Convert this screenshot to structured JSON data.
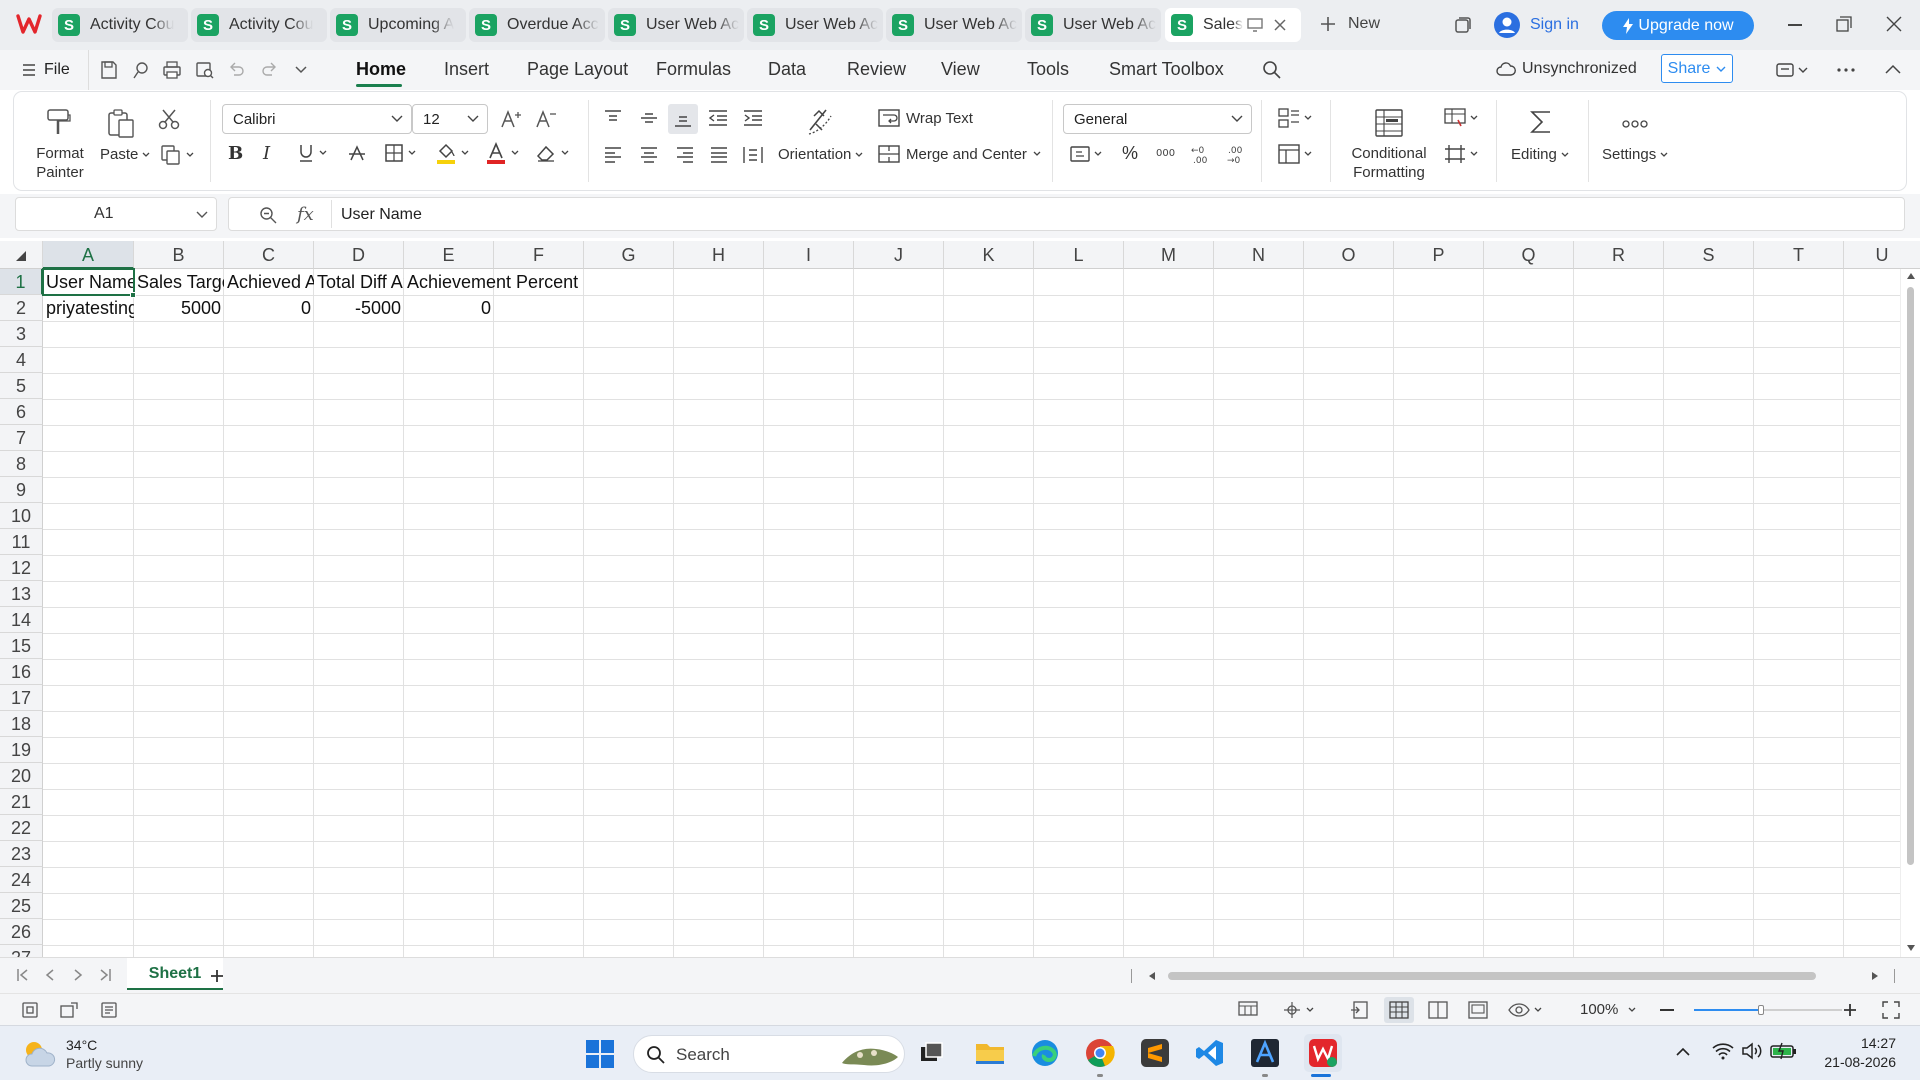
{
  "tabs": [
    {
      "label": "Activity Cou",
      "icon": "S"
    },
    {
      "label": "Activity Cou",
      "icon": "S"
    },
    {
      "label": "Upcoming A",
      "icon": "S"
    },
    {
      "label": "Overdue Acc",
      "icon": "S"
    },
    {
      "label": "User Web Ac",
      "icon": "S"
    },
    {
      "label": "User Web Ac",
      "icon": "S"
    },
    {
      "label": "User Web Ac",
      "icon": "S"
    },
    {
      "label": "User Web Ac",
      "icon": "S"
    },
    {
      "label": "Sales",
      "icon": "S"
    }
  ],
  "titlebar": {
    "new_label": "New",
    "signin_label": "Sign in",
    "upgrade_label": "Upgrade now"
  },
  "menu": {
    "file": "File",
    "items": [
      "Home",
      "Insert",
      "Page Layout",
      "Formulas",
      "Data",
      "Review",
      "View",
      "Tools",
      "Smart Toolbox"
    ],
    "active": "Home",
    "sync_status": "Unsynchronized",
    "share_label": "Share"
  },
  "ribbon": {
    "format_painter": "Format Painter",
    "paste": "Paste",
    "font_name": "Calibri",
    "font_size": "12",
    "wrap_text": "Wrap Text",
    "orientation": "Orientation",
    "merge_center": "Merge and Center",
    "number_format": "General",
    "conditional_formatting": "Conditional Formatting",
    "editing": "Editing",
    "settings": "Settings"
  },
  "formula_bar": {
    "cell_ref": "A1",
    "fx": "fx",
    "content": "User Name"
  },
  "columns": [
    "A",
    "B",
    "C",
    "D",
    "E",
    "F",
    "G",
    "H",
    "I",
    "J",
    "K",
    "L",
    "M",
    "N",
    "O",
    "P",
    "Q",
    "R",
    "S",
    "T",
    "U"
  ],
  "rows": [
    "1",
    "2",
    "3",
    "4",
    "5",
    "6",
    "7",
    "8",
    "9",
    "10",
    "11",
    "12",
    "13",
    "14",
    "15",
    "16",
    "17",
    "18",
    "19",
    "20",
    "21",
    "22",
    "23",
    "24",
    "25",
    "26",
    "27"
  ],
  "cells": {
    "A1": "User Name",
    "B1": "Sales Target",
    "C1": "Achieved Amount",
    "D1": "Total Diff Amount",
    "E1": "Achievement Percent",
    "A2": "priyatesting",
    "B2": "5000",
    "C2": "0",
    "D2": "-5000",
    "E2": "0"
  },
  "sheets": [
    "Sheet1"
  ],
  "status": {
    "zoom": "100%"
  },
  "taskbar": {
    "temperature": "34°C",
    "weather": "Partly sunny",
    "search_placeholder": "Search",
    "time": "14:27",
    "date": "21-08-2026"
  },
  "colors": {
    "accent": "#1a7f4e",
    "sheet_icon": "#1ba362",
    "upgrade": "#2d8cf0",
    "selection": "#1e7145"
  }
}
